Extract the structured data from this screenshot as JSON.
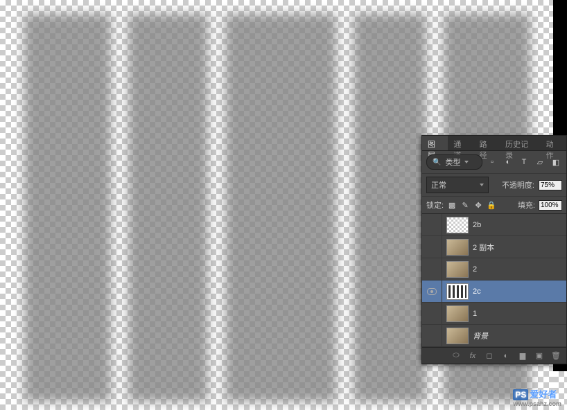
{
  "tabs": {
    "layers": "图层",
    "channels": "通道",
    "paths": "路径",
    "history": "历史记录",
    "actions": "动作"
  },
  "filter": {
    "kind": "类型"
  },
  "blend": {
    "mode": "正常",
    "opacity_label": "不透明度:",
    "opacity_value": "75%"
  },
  "lock": {
    "label": "锁定:",
    "fill_label": "填充:",
    "fill_value": "100%"
  },
  "layers": [
    {
      "name": "2b",
      "visible": false,
      "thumb": "checker",
      "selected": false
    },
    {
      "name": "2 副本",
      "visible": false,
      "thumb": "img",
      "selected": false
    },
    {
      "name": "2",
      "visible": false,
      "thumb": "img",
      "selected": false
    },
    {
      "name": "2c",
      "visible": true,
      "thumb": "bars",
      "selected": true
    },
    {
      "name": "1",
      "visible": false,
      "thumb": "img",
      "selected": false
    },
    {
      "name": "背景",
      "visible": false,
      "thumb": "img",
      "selected": false,
      "italic": true
    }
  ],
  "watermark": {
    "brand_ps": "PS",
    "brand": "爱好者",
    "url": "www.psahz.com"
  }
}
